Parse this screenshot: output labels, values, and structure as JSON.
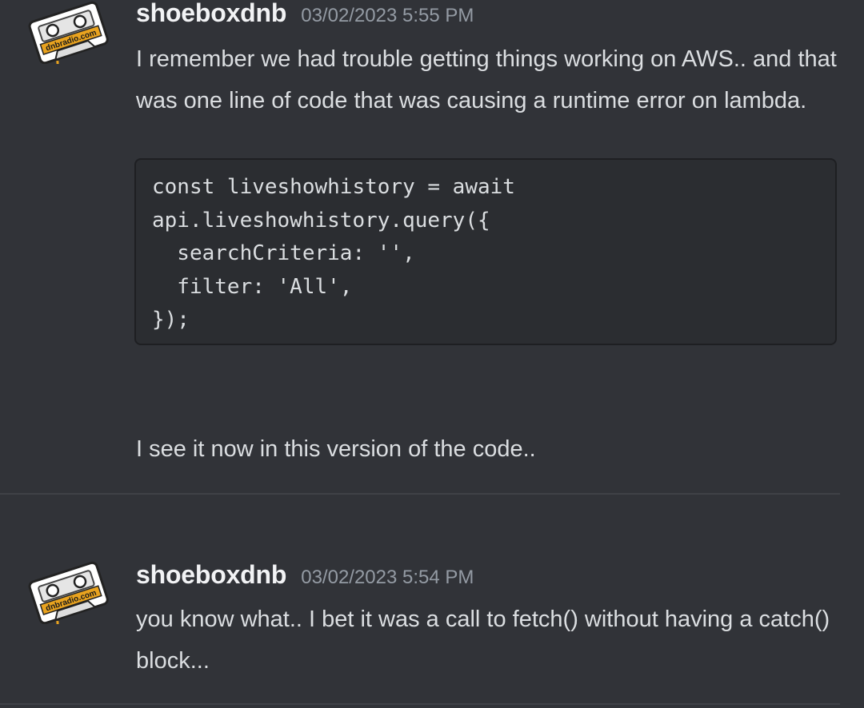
{
  "messages": [
    {
      "username": "shoeboxdnb",
      "timestamp": "03/02/2023 5:55 PM",
      "avatar_text": "dnbradio.com",
      "text": "I remember we had trouble getting things working on AWS.. and that was one line of code that was causing a runtime error on lambda.",
      "code": "const liveshowhistory = await\napi.liveshowhistory.query({\n  searchCriteria: '',\n  filter: 'All',\n});",
      "followup": "I see it now in this version of the code.."
    },
    {
      "username": "shoeboxdnb",
      "timestamp": "03/02/2023 5:54 PM",
      "avatar_text": "dnbradio.com",
      "text": "you know what.. I bet it was a call to fetch() without having a catch() block..."
    }
  ],
  "colors": {
    "background": "#313338",
    "username": "#f2f3f5",
    "timestamp": "#949ba4",
    "text": "#dbdee1",
    "code_bg": "#2b2d31",
    "avatar_accent": "#e9a31f"
  }
}
